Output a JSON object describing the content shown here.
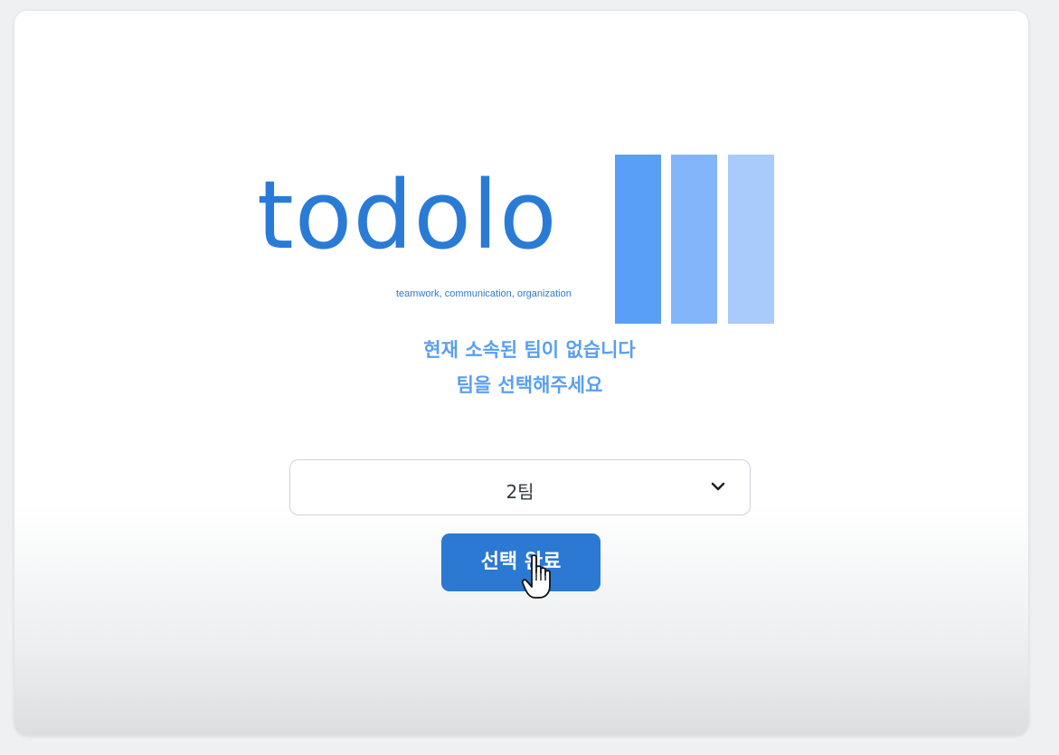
{
  "logo": {
    "wordmark": "todolo",
    "tagline": "teamwork, communication, organization",
    "bar_colors": [
      "#5a9ff7",
      "#82b5fa",
      "#a8cbfc"
    ],
    "text_color": "#2a7bd6"
  },
  "message": {
    "line1": "현재 소속된 팀이 없습니다",
    "line2": "팀을 선택해주세요",
    "color": "#5a9ff0"
  },
  "team_select": {
    "selected": "2팀",
    "icon": "chevron-down-icon"
  },
  "confirm_button": {
    "label": "선택 완료",
    "color": "#2b79d2"
  },
  "pointer": {
    "icon": "hand-pointer-icon"
  }
}
